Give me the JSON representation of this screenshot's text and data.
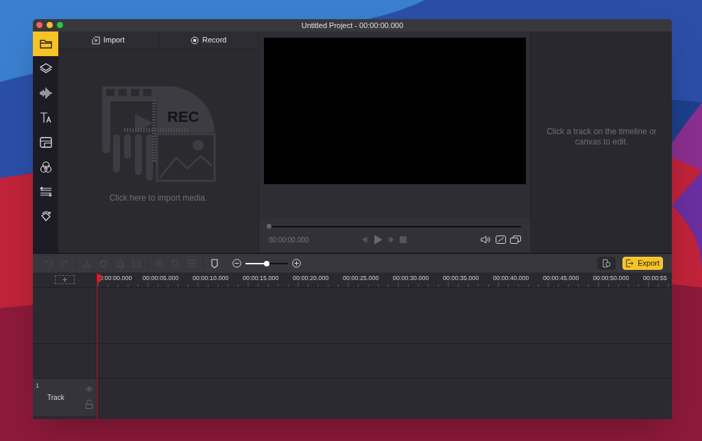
{
  "window": {
    "title": "Untitled Project - 00:00:00.000"
  },
  "sidebar": {
    "items": [
      {
        "kind": "folder",
        "selected": true
      },
      {
        "kind": "layers",
        "selected": false
      },
      {
        "kind": "audio",
        "selected": false
      },
      {
        "kind": "text",
        "selected": false
      },
      {
        "kind": "template",
        "selected": false
      },
      {
        "kind": "filters",
        "selected": false
      },
      {
        "kind": "transitions",
        "selected": false
      },
      {
        "kind": "rotate",
        "selected": false
      }
    ]
  },
  "media": {
    "tabs": [
      {
        "label": "Import",
        "kind": "import"
      },
      {
        "label": "Record",
        "kind": "record"
      }
    ],
    "illustration_text": "REC",
    "hint": "Click here to import media."
  },
  "player": {
    "level": 0,
    "time": "00:00:00.000"
  },
  "inspector": {
    "hint": "Click a track on the timeline or canvas to edit."
  },
  "toolbar": {
    "tools": [
      {
        "kind": "undo",
        "disabled": true
      },
      {
        "kind": "redo",
        "disabled": true
      },
      {
        "kind": "cut",
        "disabled": true
      },
      {
        "kind": "copy",
        "disabled": true
      },
      {
        "kind": "paste",
        "disabled": true
      },
      {
        "kind": "delete",
        "disabled": true
      },
      {
        "kind": "split",
        "disabled": true
      },
      {
        "kind": "crop",
        "disabled": true
      },
      {
        "kind": "mosaic",
        "disabled": true
      },
      {
        "kind": "marker",
        "disabled": false
      }
    ],
    "zoom": {
      "level": 0.5
    },
    "export": "Export"
  },
  "ruler": {
    "labels": [
      "0:00:00.000",
      "00:00:05.000",
      "00:00:10.000",
      "00:00:15.000",
      "00:00:20.000",
      "00:00:25.000",
      "00:00:30.000",
      "00:00:35.000",
      "00:00:40.000",
      "00:00:45.000",
      "00:00:50.000",
      "00:00:55"
    ]
  },
  "tracks": [
    {
      "number": "1",
      "name": "Track",
      "visible": true,
      "locked": false
    }
  ]
}
